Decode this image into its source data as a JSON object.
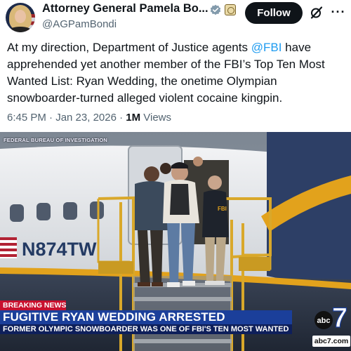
{
  "tweet": {
    "author_name": "Attorney General Pamela Bo...",
    "handle": "@AGPamBondi",
    "follow_label": "Follow",
    "more_label": "···",
    "body": {
      "part1": "At my direction, Department of Justice agents ",
      "mention": "@FBI",
      "part2": " have apprehended yet another member of the FBI’s Top Ten Most Wanted List: Ryan Wedding, the onetime Olympian snowboarder-turned alleged violent cocaine kingpin."
    },
    "timestamp": "6:45 PM · Jan 23, 2026 · ",
    "views_count": "1M",
    "views_label": " Views"
  },
  "media": {
    "source_caption": "FEDERAL BUREAU OF INVESTIGATION",
    "tail_number": "N874TW",
    "jacket_text": "FBI",
    "breaking_label": "BREAKING NEWS",
    "headline": "FUGITIVE RYAN WEDDING ARRESTED",
    "subheadline": "FORMER OLYMPIC SNOWBOARDER WAS ONE OF FBI'S TEN MOST WANTED",
    "network_logo": "abc",
    "channel_number": "7",
    "network_site": "abc7.com"
  },
  "icons": [
    "verified-badge-icon",
    "government-seal-icon",
    "grok-icon",
    "more-options-icon"
  ],
  "colors": {
    "text_primary": "#0f1419",
    "text_secondary": "#536471",
    "link": "#1d9bf0",
    "verified": "#829aab",
    "breaking_red": "#c8102e",
    "headline_blue": "#1b3f9a",
    "plane_stripe": "#e2a21c"
  }
}
